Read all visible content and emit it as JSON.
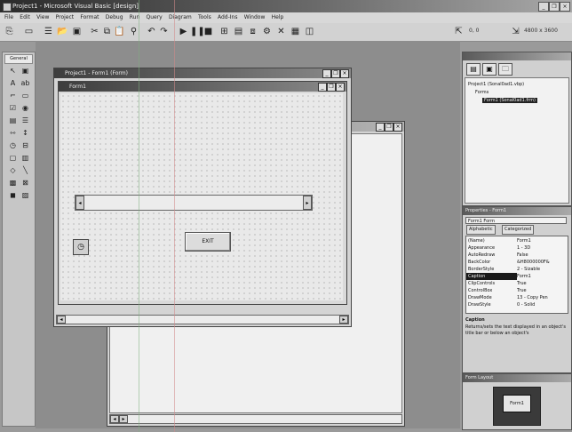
{
  "app": {
    "title": "Project1 - Microsoft Visual Basic [design]",
    "window_controls": [
      "_",
      "❐",
      "×"
    ]
  },
  "menu": [
    "File",
    "Edit",
    "View",
    "Project",
    "Format",
    "Debug",
    "Run",
    "Query",
    "Diagram",
    "Tools",
    "Add-Ins",
    "Window",
    "Help"
  ],
  "toolbar": {
    "coords": "0, 0",
    "size": "4800 x 3600"
  },
  "toolbox": {
    "title": "General"
  },
  "designer_window": {
    "title": "Project1 - Form1 (Form)"
  },
  "form": {
    "caption": "Form1",
    "exit_button_label": "EXIT"
  },
  "project_explorer": {
    "tree": [
      {
        "label": "Project1 (Sonal0ad1.vbp)"
      },
      {
        "label": "Forms"
      },
      {
        "label": "Form1 (Sonal0ad1.frm)"
      }
    ]
  },
  "properties": {
    "title": "Properties - Form1",
    "object": "Form1 Form",
    "tabs": [
      "Alphabetic",
      "Categorized"
    ],
    "rows": [
      {
        "name": "(Name)",
        "value": "Form1"
      },
      {
        "name": "Appearance",
        "value": "1 - 3D"
      },
      {
        "name": "AutoRedraw",
        "value": "False"
      },
      {
        "name": "BackColor",
        "value": "&H8000000F&"
      },
      {
        "name": "BorderStyle",
        "value": "2 - Sizable"
      },
      {
        "name": "Caption",
        "value": "Form1",
        "selected": true
      },
      {
        "name": "ClipControls",
        "value": "True"
      },
      {
        "name": "ControlBox",
        "value": "True"
      },
      {
        "name": "DrawMode",
        "value": "13 - Copy Pen"
      },
      {
        "name": "DrawStyle",
        "value": "0 - Solid"
      }
    ],
    "description_title": "Caption",
    "description_text": "Returns/sets the text displayed in an object's title bar or below an object's"
  },
  "form_layout": {
    "title": "Form Layout",
    "preview_label": "Form1"
  },
  "colors": {
    "accent_title": "#3d3d3d",
    "selected_row": "#1a1a1a",
    "mdi_background": "#8d8d8d"
  }
}
